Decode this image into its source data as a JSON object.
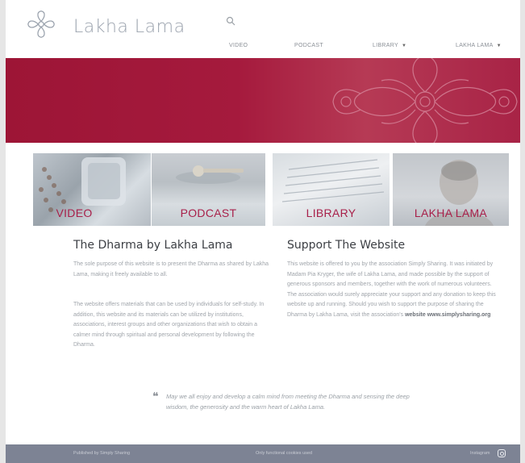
{
  "header": {
    "logo_text": "Lakha Lama",
    "nav": [
      {
        "label": "VIDEO",
        "has_caret": false
      },
      {
        "label": "PODCAST",
        "has_caret": false
      },
      {
        "label": "LIBRARY",
        "has_caret": true
      },
      {
        "label": "LAKHA LAMA",
        "has_caret": true
      }
    ],
    "caret": "▼"
  },
  "tiles": [
    {
      "label": "VIDEO"
    },
    {
      "label": "PODCAST"
    },
    {
      "label": "LIBRARY"
    },
    {
      "label": "LAKHA LAMA"
    }
  ],
  "left_column": {
    "title": "The Dharma by Lakha Lama",
    "p1": "The sole purpose of this website is to present the Dharma as shared by Lakha Lama, making it freely available to all.",
    "p2": "The website offers materials that can be used by individuals for self-study. In addition, this website and its materials can be utilized by institutions, associations, interest groups and other organizations that wish to obtain a calmer mind through spiritual and personal development by following the Dharma."
  },
  "right_column": {
    "title": "Support The Website",
    "p1": "This website is offered to you by the association Simply Sharing. It was initiated by Madam Pia Kryger, the wife of Lakha Lama, and made possible by the support of generous sponsors and members, together with the work of numerous volunteers. The association would surely appreciate your support and any donation to keep this website up and running. Should you wish to support the purpose of sharing the Dharma by Lakha Lama, visit the association's",
    "link_label": "website",
    "link_url_text": "www.simplysharing.org"
  },
  "quote": {
    "mark": "❝",
    "text": "May we all enjoy and develop a calm mind from meeting the Dharma and sensing the deep wisdom, the generosity and the warm heart of Lakha Lama."
  },
  "footer": {
    "left": "Published by Simply Sharing",
    "center": "Only functional cookies used",
    "right": "Instagram"
  },
  "colors": {
    "accent": "#a8204a",
    "banner": "#9d1536",
    "footer": "#7d8394"
  }
}
